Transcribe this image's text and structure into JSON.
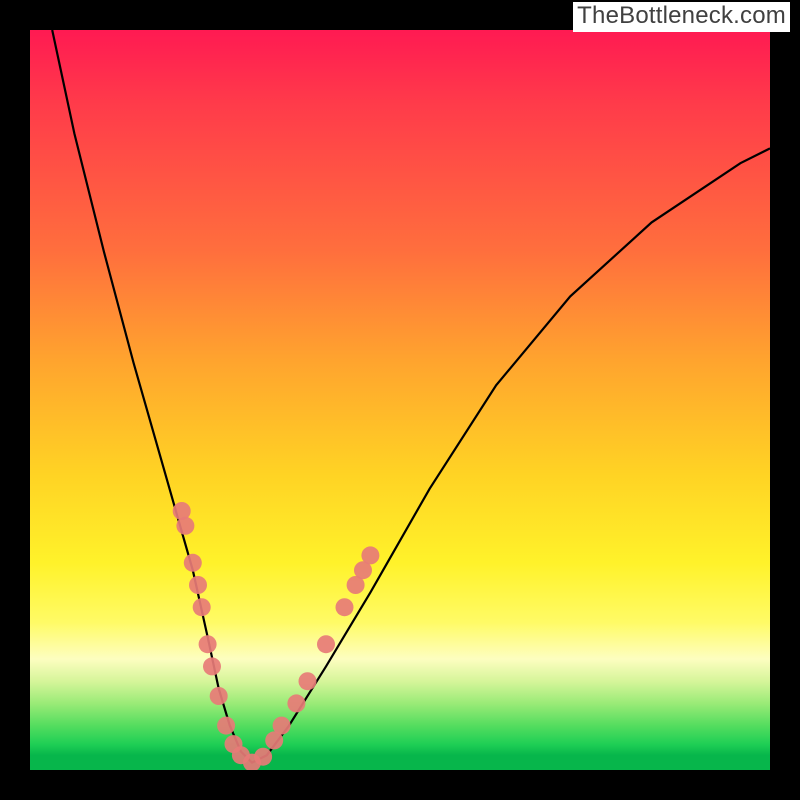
{
  "watermark": "TheBottleneck.com",
  "chart_data": {
    "type": "line",
    "title": "",
    "xlabel": "",
    "ylabel": "",
    "xlim": [
      0,
      100
    ],
    "ylim": [
      0,
      100
    ],
    "grid": false,
    "legend": false,
    "series": [
      {
        "name": "bottleneck-curve",
        "x": [
          3,
          6,
          10,
          14,
          18,
          20,
          22,
          24,
          25.5,
          27,
          28.5,
          30,
          32,
          35,
          40,
          46,
          54,
          63,
          73,
          84,
          96,
          100
        ],
        "y": [
          100,
          86,
          70,
          55,
          41,
          34,
          27,
          18,
          11,
          6,
          2.5,
          1,
          2,
          6,
          14,
          24,
          38,
          52,
          64,
          74,
          82,
          84
        ]
      }
    ],
    "markers": [
      {
        "x": 20.5,
        "y": 35
      },
      {
        "x": 21,
        "y": 33
      },
      {
        "x": 22,
        "y": 28
      },
      {
        "x": 22.7,
        "y": 25
      },
      {
        "x": 23.2,
        "y": 22
      },
      {
        "x": 24,
        "y": 17
      },
      {
        "x": 24.6,
        "y": 14
      },
      {
        "x": 25.5,
        "y": 10
      },
      {
        "x": 26.5,
        "y": 6
      },
      {
        "x": 27.5,
        "y": 3.5
      },
      {
        "x": 28.5,
        "y": 2
      },
      {
        "x": 30,
        "y": 1
      },
      {
        "x": 31.5,
        "y": 1.8
      },
      {
        "x": 33,
        "y": 4
      },
      {
        "x": 34,
        "y": 6
      },
      {
        "x": 36,
        "y": 9
      },
      {
        "x": 37.5,
        "y": 12
      },
      {
        "x": 40,
        "y": 17
      },
      {
        "x": 42.5,
        "y": 22
      },
      {
        "x": 44,
        "y": 25
      },
      {
        "x": 45,
        "y": 27
      },
      {
        "x": 46,
        "y": 29
      }
    ],
    "annotations": []
  }
}
